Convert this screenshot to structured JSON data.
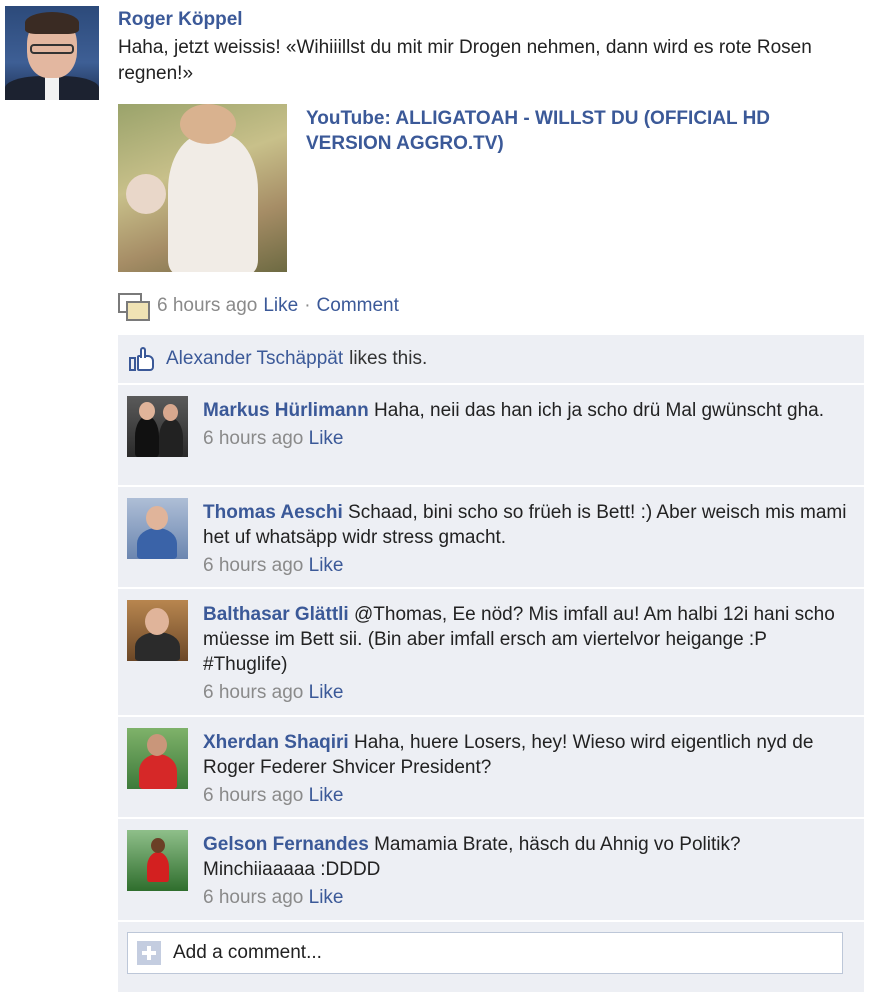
{
  "post": {
    "author": "Roger Köppel",
    "message": "Haha, jetzt weissis! «Wihiiillst du mit mir Drogen nehmen, dann wird es rote Rosen regnen!»",
    "link_title": "YouTube: ALLIGATOAH - WILLST DU (OFFICIAL HD VERSION AGGRO.TV)",
    "time": "6 hours ago",
    "like_label": "Like",
    "separator": "·",
    "comment_label": "Comment"
  },
  "likes": {
    "liker": "Alexander Tschäppät",
    "text": "likes this."
  },
  "comments": [
    {
      "name": "Markus Hürlimann",
      "text": "Haha, neii das han ich ja scho drü Mal gwünscht gha.",
      "time": "6 hours ago",
      "like": "Like"
    },
    {
      "name": "Thomas Aeschi",
      "text": "Schaad, bini scho so früeh is Bett! :) Aber weisch mis mami het uf whatsäpp widr stress gmacht.",
      "time": "6 hours ago",
      "like": "Like"
    },
    {
      "name": "Balthasar Glättli",
      "text": "@Thomas, Ee nöd? Mis imfall au! Am halbi 12i hani scho müesse im Bett sii. (Bin aber imfall ersch am viertelvor heigange :P #Thuglife)",
      "time": "6 hours ago",
      "like": "Like"
    },
    {
      "name": "Xherdan Shaqiri",
      "text": "Haha, huere Losers, hey! Wieso wird eigentlich nyd de Roger Federer Shvicer President?",
      "time": "6 hours ago",
      "like": "Like"
    },
    {
      "name": "Gelson Fernandes",
      "text": "Mamamia Brate, häsch du Ahnig vo Politik? Minchiiaaaaa :DDDD",
      "time": "6 hours ago",
      "like": "Like"
    }
  ],
  "add_comment": {
    "placeholder": "Add a comment..."
  },
  "colors": {
    "link": "#3b5998",
    "ufi_background": "#edeff4",
    "meta_text": "#8a8a8a"
  },
  "icons": [
    "attachment-icon",
    "thumbs-up-icon",
    "plus-icon"
  ]
}
